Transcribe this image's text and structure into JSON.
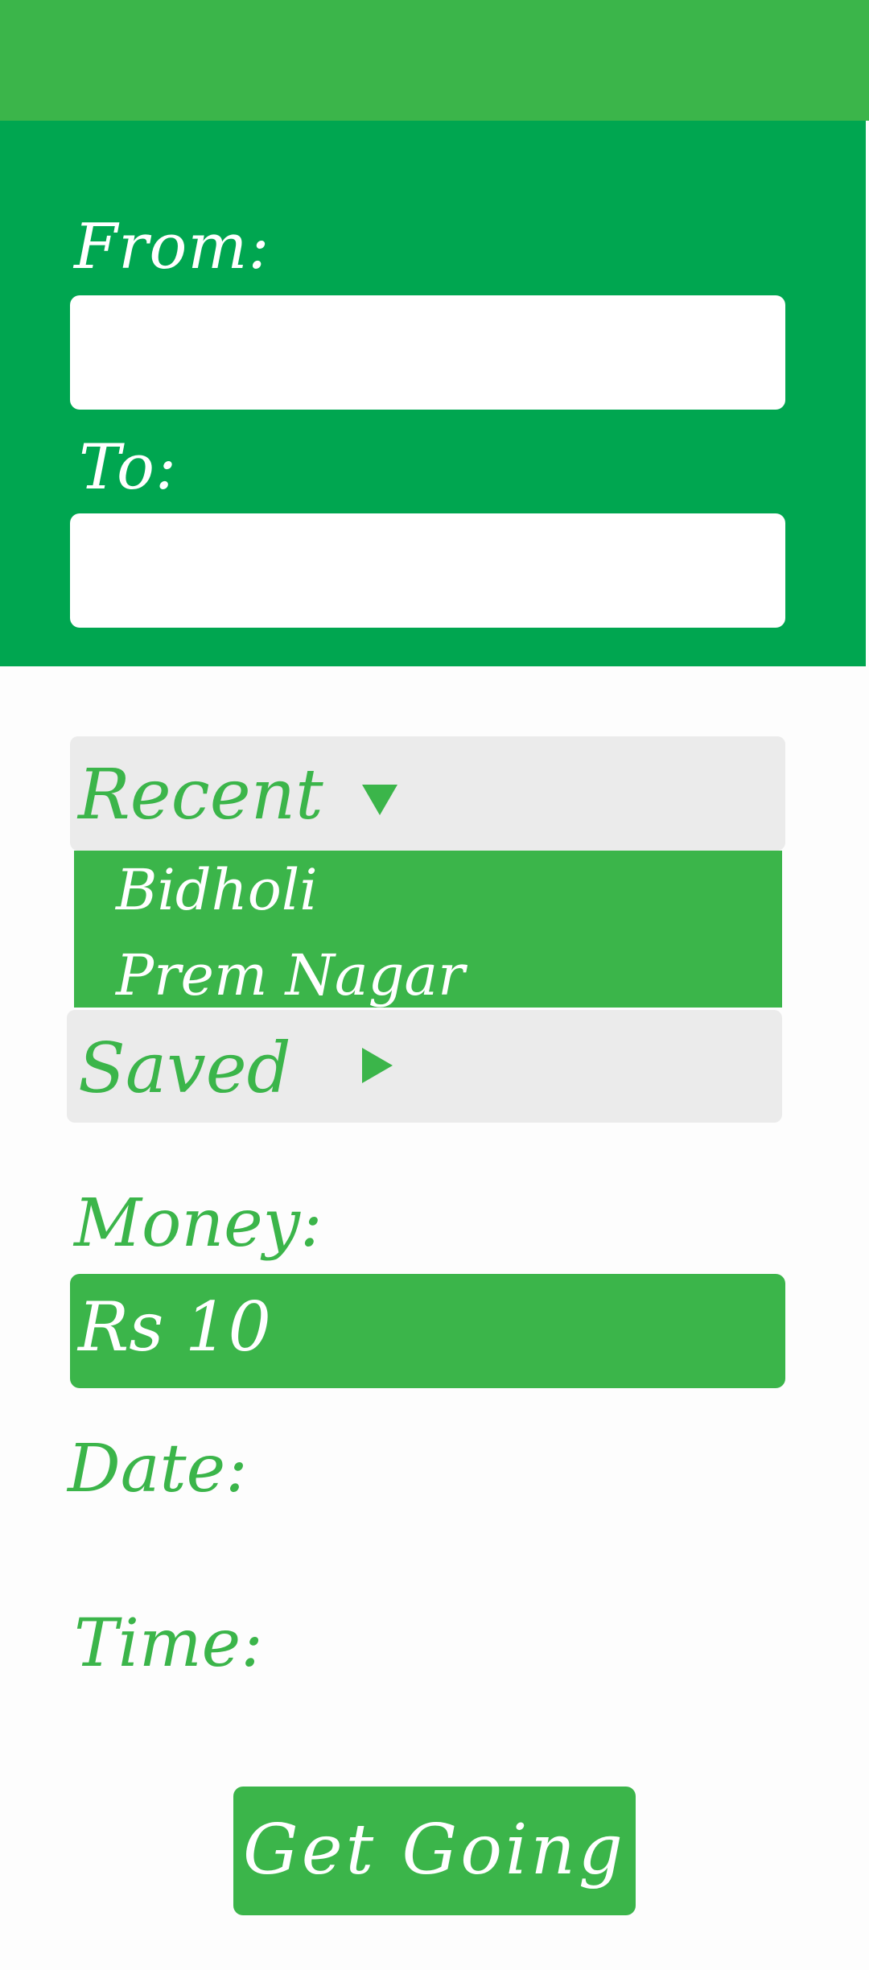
{
  "colors": {
    "top_bar": "#3bb54a",
    "header_panel": "#00a650",
    "accent": "#3bb54a",
    "section_bg": "#ebebeb",
    "page_bg": "#fdfdfd"
  },
  "form": {
    "from_label": "From:",
    "from_value": "",
    "to_label": "To:",
    "to_value": ""
  },
  "recent": {
    "label": "Recent",
    "toggle_icon": "triangle-down-icon",
    "expanded": true,
    "items": [
      "Bidholi",
      "Prem Nagar"
    ]
  },
  "saved": {
    "label": "Saved",
    "toggle_icon": "triangle-right-icon",
    "expanded": false
  },
  "money": {
    "label": "Money:",
    "value": "Rs 10"
  },
  "date": {
    "label": "Date:"
  },
  "time": {
    "label": "Time:"
  },
  "action": {
    "label": "Get Going"
  }
}
